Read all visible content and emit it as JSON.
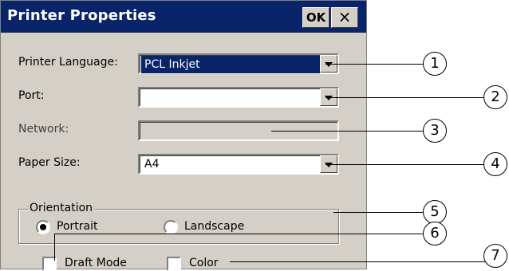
{
  "dialog": {
    "title": "Printer Properties",
    "ok_label": "OK",
    "close_label": "×"
  },
  "fields": {
    "printer_language": {
      "label": "Printer Language:",
      "value": "PCL Inkjet"
    },
    "port": {
      "label": "Port:",
      "value": ""
    },
    "network": {
      "label": "Network:",
      "value": ""
    },
    "paper_size": {
      "label": "Paper Size:",
      "value": "A4"
    }
  },
  "orientation": {
    "legend": "Orientation",
    "portrait_label": "Portrait",
    "landscape_label": "Landscape",
    "selected": "Portrait"
  },
  "options": {
    "draft_mode_label": "Draft Mode",
    "draft_mode_checked": false,
    "color_label": "Color",
    "color_checked": false
  },
  "callouts": [
    "1",
    "2",
    "3",
    "4",
    "5",
    "6",
    "7"
  ],
  "colors": {
    "title_bar": "#0a246a",
    "dialog_bg": "#d4d0c8",
    "selection": "#0a246a"
  }
}
